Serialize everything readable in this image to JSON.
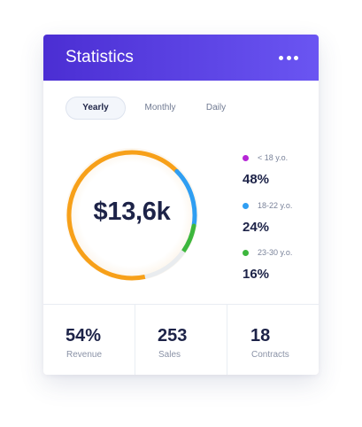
{
  "header": {
    "title": "Statistics",
    "menu_icon": "more-horizontal-icon"
  },
  "tabs": [
    {
      "label": "Yearly",
      "active": true
    },
    {
      "label": "Monthly",
      "active": false
    },
    {
      "label": "Daily",
      "active": false
    }
  ],
  "summary": {
    "total": "$13,6k",
    "ring_segments": [
      {
        "color": "#f7a019",
        "share": 0.66
      },
      {
        "color": "#2f9ef2",
        "share": 0.15
      },
      {
        "color": "#3db73d",
        "share": 0.07
      },
      {
        "color": "#e9ecef",
        "share": 0.12
      }
    ]
  },
  "legend": [
    {
      "label": "< 18 y.o.",
      "value": "48%",
      "color": "#b626d6"
    },
    {
      "label": "18-22 y.o.",
      "value": "24%",
      "color": "#2f9ef2"
    },
    {
      "label": "23-30 y.o.",
      "value": "16%",
      "color": "#3db73d"
    }
  ],
  "stats": [
    {
      "value": "54%",
      "label": "Revenue"
    },
    {
      "value": "253",
      "label": "Sales"
    },
    {
      "value": "18",
      "label": "Contracts"
    }
  ]
}
